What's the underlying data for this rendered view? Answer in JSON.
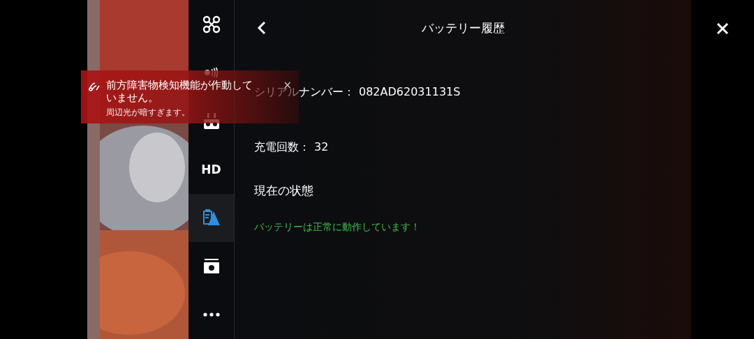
{
  "notification": {
    "title": "前方障害物検知機能が作動していません。",
    "detail": "周辺光が暗すぎます。",
    "close": "×"
  },
  "sidebar": {
    "items": [
      {
        "kind": "drone",
        "selected": false
      },
      {
        "kind": "signal",
        "selected": false
      },
      {
        "kind": "remote",
        "selected": false
      },
      {
        "kind": "text",
        "label": "HD",
        "selected": false
      },
      {
        "kind": "battery",
        "selected": true
      },
      {
        "kind": "camera",
        "selected": false
      },
      {
        "kind": "more",
        "selected": false
      }
    ]
  },
  "header": {
    "title": "バッテリー履歴"
  },
  "details": {
    "serial_label": "シリアルナンバー：",
    "serial": "082AD62031131S",
    "cycles_label": "充電回数：",
    "cycles": "32",
    "status_heading": "現在の状態",
    "status": "バッテリーは正常に動作しています！"
  }
}
